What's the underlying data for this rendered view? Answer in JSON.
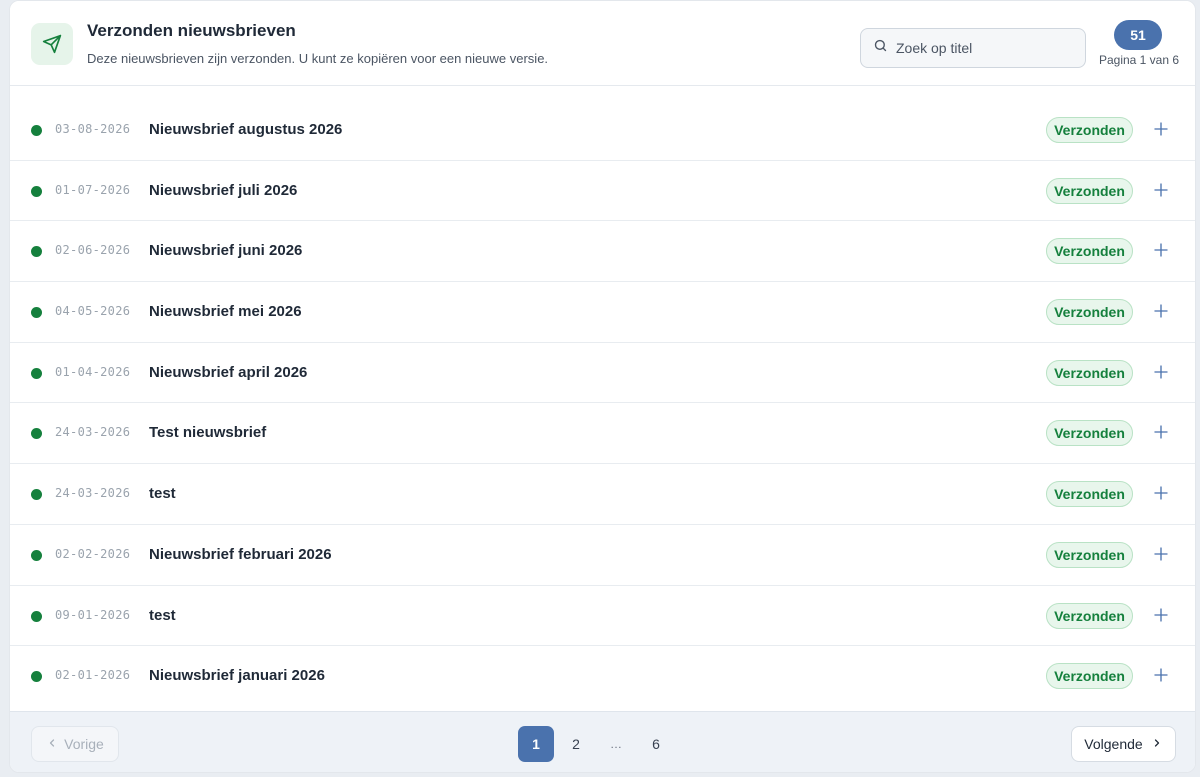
{
  "header": {
    "icon": "send-icon",
    "title": "Verzonden nieuwsbrieven",
    "subtitle": "Deze nieuwsbrieven zijn verzonden. U kunt ze kopiëren voor een nieuwe versie.",
    "search_placeholder": "Zoek op titel",
    "count": "51",
    "page_info": "Pagina 1 van 6"
  },
  "newsletters": [
    {
      "date": "03-08-2026",
      "title": "Nieuwsbrief augustus 2026",
      "status": "Verzonden"
    },
    {
      "date": "01-07-2026",
      "title": "Nieuwsbrief juli 2026",
      "status": "Verzonden"
    },
    {
      "date": "02-06-2026",
      "title": "Nieuwsbrief juni 2026",
      "status": "Verzonden"
    },
    {
      "date": "04-05-2026",
      "title": "Nieuwsbrief mei 2026",
      "status": "Verzonden"
    },
    {
      "date": "01-04-2026",
      "title": "Nieuwsbrief april 2026",
      "status": "Verzonden"
    },
    {
      "date": "24-03-2026",
      "title": "Test nieuwsbrief",
      "status": "Verzonden"
    },
    {
      "date": "24-03-2026",
      "title": "test",
      "status": "Verzonden"
    },
    {
      "date": "02-02-2026",
      "title": "Nieuwsbrief februari 2026",
      "status": "Verzonden"
    },
    {
      "date": "09-01-2026",
      "title": "test",
      "status": "Verzonden"
    },
    {
      "date": "02-01-2026",
      "title": "Nieuwsbrief januari 2026",
      "status": "Verzonden"
    }
  ],
  "pagination": {
    "prev_label": "Vorige",
    "next_label": "Volgende",
    "pages": [
      "1",
      "2",
      "…",
      "6"
    ],
    "current": "1"
  },
  "colors": {
    "accent": "#4a72ad",
    "status_green": "#15803d",
    "status_bg": "#e8f6ec"
  }
}
